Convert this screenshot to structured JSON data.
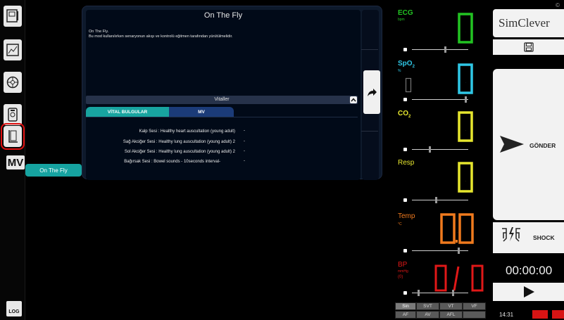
{
  "panel": {
    "title": "On The Fly",
    "desc_line1": "On The Fly.",
    "desc_line2": "Bu mod kullanılırken senaryonun akışı ve kontrolü eğitmen tarafından yürütülmelidir.",
    "vitals_section": "Vitaller",
    "tab_vital": "VİTAL BULGULAR",
    "tab_mv": "MV",
    "findings": [
      {
        "label": "Kalp Sesi : Healthy heart auscultation (young adult)",
        "value": "-"
      },
      {
        "label": "Sağ Akciğer Sesi : Healthy lung auscultation (young adult) 2",
        "value": "-"
      },
      {
        "label": "Sol Akciğer Sesi : Healthy lung auscultation (young adult) 2",
        "value": "-"
      },
      {
        "label": "Bağırsak Sesi : Bowel sounds - 10seconds interval-",
        "value": "-"
      }
    ]
  },
  "sidebar": {
    "mv_label": "MV",
    "log_label": "LOG",
    "active_mode_tab": "On The Fly"
  },
  "monitor": {
    "ecg": {
      "label": "ECG",
      "unit": "bpm",
      "value": "0",
      "color": "#22c322"
    },
    "spo2": {
      "label": "SpO2",
      "unit": "%",
      "value": "0",
      "color": "#2fc7e6"
    },
    "co2": {
      "label": "CO2",
      "value": "0",
      "color": "#e6e62e"
    },
    "resp": {
      "label": "Resp",
      "value": "0",
      "color": "#e6e62e"
    },
    "temp": {
      "label": "Temp",
      "unit": "°C",
      "value": "0,0",
      "color": "#f07a1e"
    },
    "bp": {
      "label": "BP",
      "unit": "mmHg",
      "unit2": "(0)",
      "value_sys": "0",
      "separator": "/",
      "value_dia": "0",
      "color": "#e01818"
    },
    "rhythms_row1": [
      "Sin",
      "SVT",
      "VT",
      "VF"
    ],
    "rhythms_row2": [
      "AF",
      "AV",
      "AFL",
      ""
    ],
    "selected_rhythm": "Sin"
  },
  "controls": {
    "logo": "SimClever",
    "logo_mark": "©",
    "send_label": "GÖNDER",
    "shock_label": "SHOCK",
    "timer": "00:00:00",
    "clock": "14:31"
  },
  "colors": {
    "accent_teal": "#18a4a0",
    "accent_blue": "#1b3b78",
    "alert_red": "#d81414"
  }
}
